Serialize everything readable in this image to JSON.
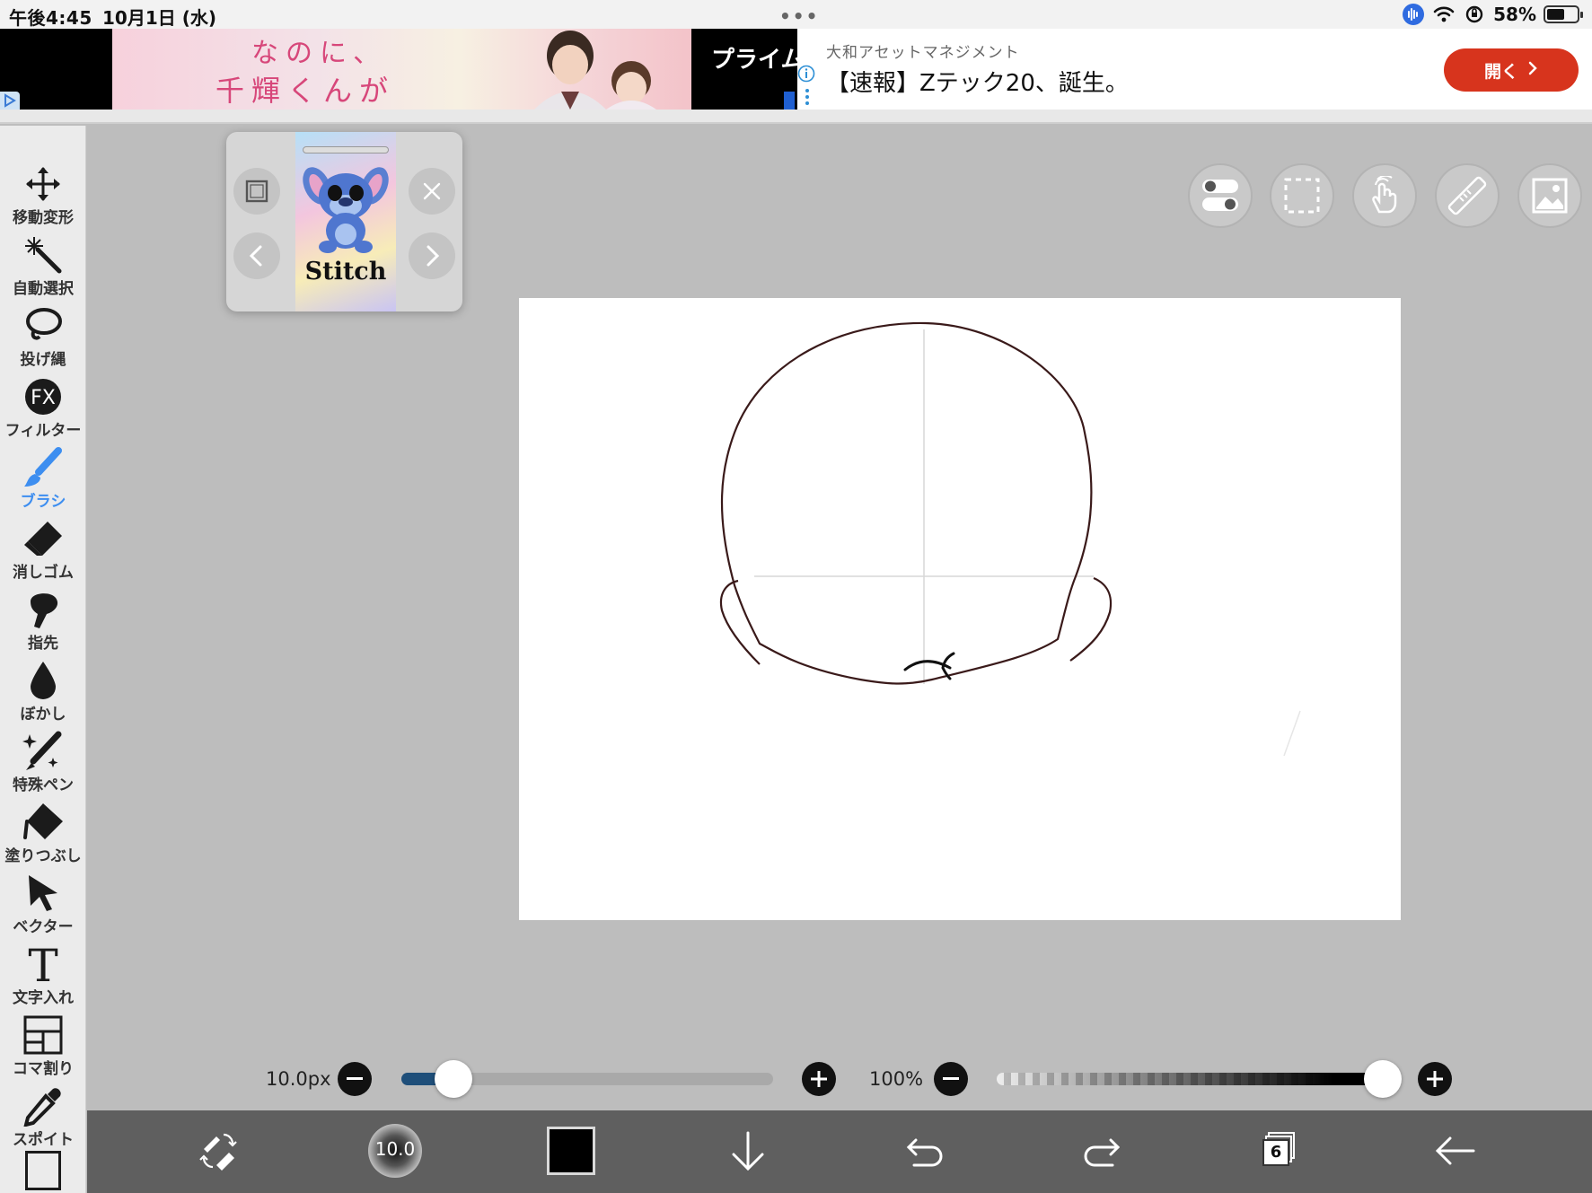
{
  "status_bar": {
    "time": "午後4:45",
    "date": "10月1日 (水)",
    "more_dots": "•••",
    "battery_percent": "58%",
    "battery_level": 0.58
  },
  "ad": {
    "image_line1": "なのに、",
    "image_line2": "千輝くんが",
    "prime_text": "プライム",
    "advertiser": "大和アセットマネジメント",
    "headline": "【速報】Zテック20、誕生。",
    "cta_label": "開く",
    "cta_color": "#d7341d"
  },
  "toolbar": {
    "items": [
      {
        "label": "移動変形",
        "icon": "move-transform-icon"
      },
      {
        "label": "自動選択",
        "icon": "magic-wand-icon"
      },
      {
        "label": "投げ縄",
        "icon": "lasso-icon"
      },
      {
        "label": "フィルター",
        "icon": "fx-filter-icon",
        "glyph": "FX"
      },
      {
        "label": "ブラシ",
        "icon": "brush-icon",
        "active": true
      },
      {
        "label": "消しゴム",
        "icon": "eraser-icon"
      },
      {
        "label": "指先",
        "icon": "smudge-icon"
      },
      {
        "label": "ぼかし",
        "icon": "blur-drop-icon"
      },
      {
        "label": "特殊ペン",
        "icon": "special-pen-icon"
      },
      {
        "label": "塗りつぶし",
        "icon": "fill-bucket-icon"
      },
      {
        "label": "ベクター",
        "icon": "vector-cursor-icon"
      },
      {
        "label": "文字入れ",
        "icon": "text-icon",
        "glyph": "T"
      },
      {
        "label": "コマ割り",
        "icon": "panel-divide-icon"
      },
      {
        "label": "スポイト",
        "icon": "eyedropper-icon"
      }
    ],
    "active_color": "#3d8ef0"
  },
  "reference_panel": {
    "caption": "Stitch"
  },
  "brush": {
    "size_label": "10.0px",
    "size_level": 0.14,
    "opacity_label": "100%",
    "opacity_level": 1.0,
    "preview_value": "10.0"
  },
  "bottom_bar": {
    "layer_count": "6",
    "current_color": "#000000"
  },
  "colors": {
    "workspace": "#bdbdbd",
    "slider_fill": "#1f4f7a",
    "sketch_line": "#3a1a1a"
  }
}
